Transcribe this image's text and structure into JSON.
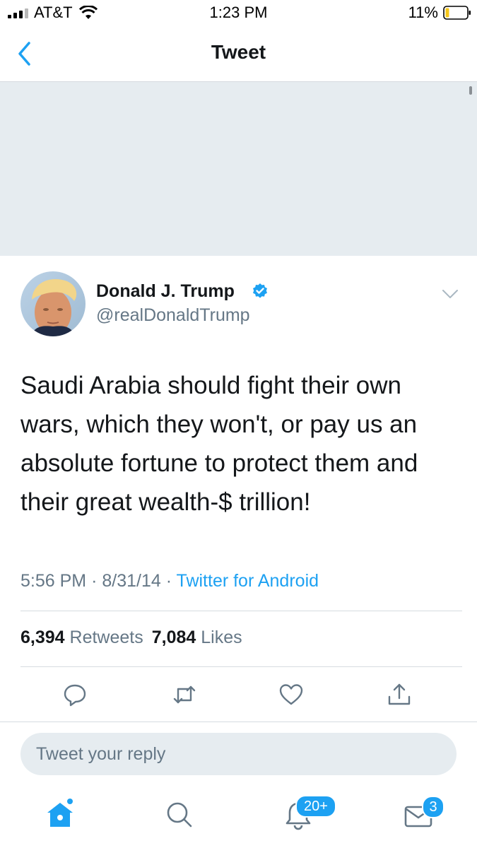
{
  "status_bar": {
    "carrier": "AT&T",
    "time": "1:23 PM",
    "battery": "11%"
  },
  "nav": {
    "title": "Tweet",
    "back_icon": "chevron-left-icon"
  },
  "tweet": {
    "author_name": "Donald J. Trump",
    "handle": "@realDonaldTrump",
    "verified": true,
    "text": "Saudi Arabia should fight their own wars, which they won't, or pay us an absolute fortune to protect them and their great wealth-$ trillion!",
    "time": "5:56 PM",
    "date": "8/31/14",
    "separator": "·",
    "source": "Twitter for Android",
    "retweets_count": "6,394",
    "retweets_label": "Retweets",
    "likes_count": "7,084",
    "likes_label": "Likes"
  },
  "actions": [
    "reply-icon",
    "retweet-icon",
    "like-icon",
    "share-icon"
  ],
  "reply": {
    "placeholder": "Tweet your reply"
  },
  "tabbar": {
    "items": [
      "home-icon",
      "search-icon",
      "notifications-icon",
      "messages-icon"
    ],
    "notifications_badge": "20+",
    "messages_badge": "3"
  },
  "colors": {
    "accent": "#1da1f2",
    "text": "#14171a",
    "secondary": "#657786",
    "background_gray": "#e6ecf0"
  }
}
